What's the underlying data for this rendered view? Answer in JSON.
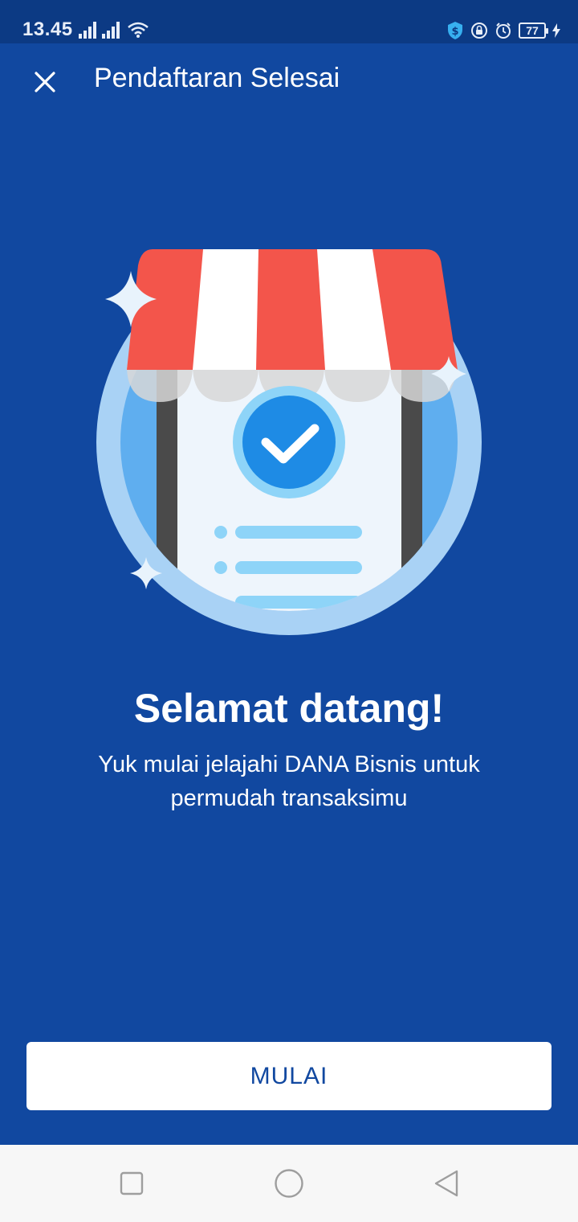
{
  "status_bar": {
    "time": "13.45",
    "battery_level": "77"
  },
  "header": {
    "title": "Pendaftaran Selesai"
  },
  "content": {
    "title": "Selamat datang!",
    "subtitle": "Yuk mulai jelajahi DANA Bisnis untuk permudah transaksimu"
  },
  "actions": {
    "start_label": "MULAI"
  },
  "colors": {
    "background": "#1148A0",
    "status_bar": "#0C3A84",
    "awning_red": "#F3554B",
    "check_blue": "#1E8BE5",
    "nav_background": "#F7F7F7"
  }
}
